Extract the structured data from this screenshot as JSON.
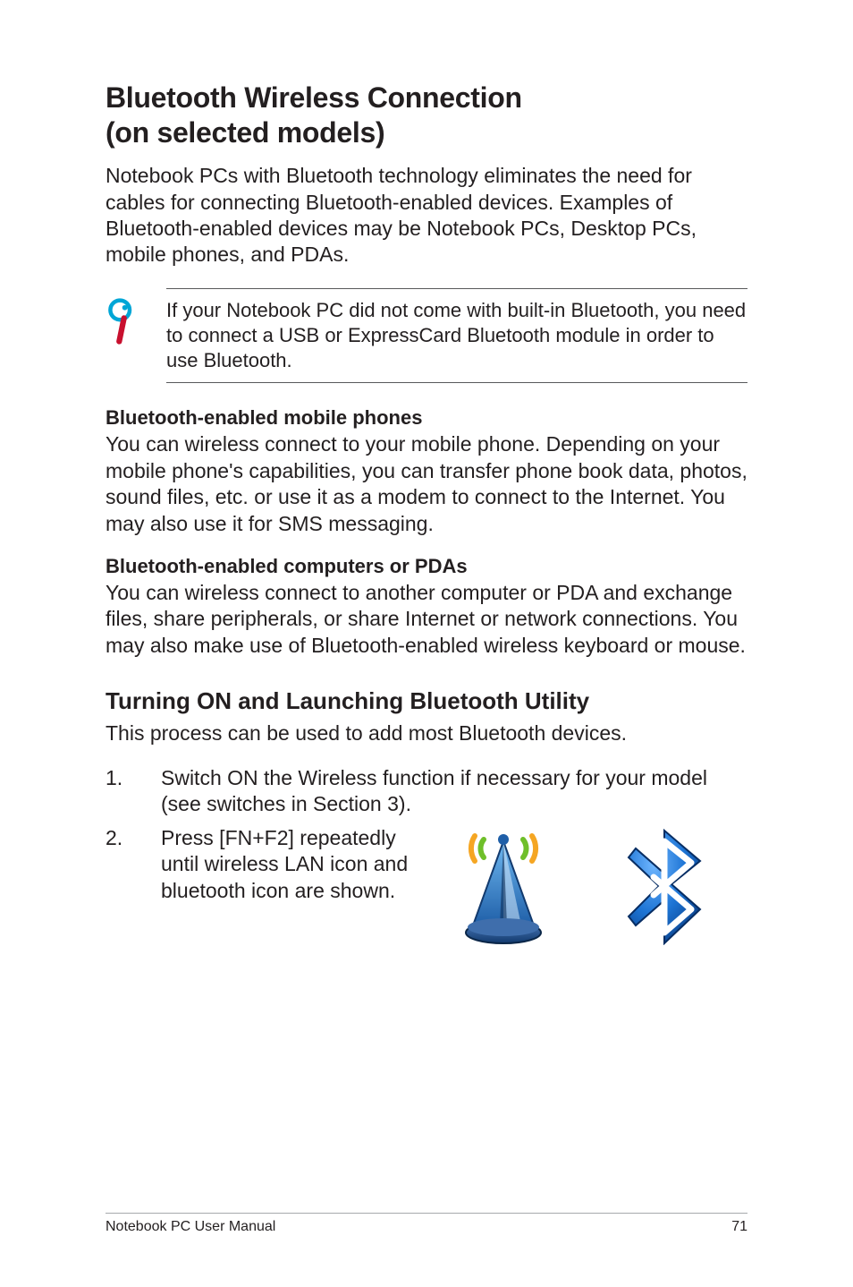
{
  "heading_line1": "Bluetooth Wireless Connection",
  "heading_line2": "(on selected models)",
  "intro": "Notebook PCs with Bluetooth technology eliminates the need for cables for connecting Bluetooth-enabled devices. Examples of Bluetooth-enabled devices may be Notebook PCs, Desktop PCs, mobile phones, and PDAs.",
  "tip": "If your Notebook PC did not come with built-in Bluetooth, you need to connect a USB or ExpressCard Bluetooth module in order to use Bluetooth.",
  "sub1_heading": "Bluetooth-enabled mobile phones",
  "sub1_body": "You can wireless connect to your mobile phone. Depending on your mobile phone's capabilities, you can transfer phone book data, photos, sound files, etc. or use it as a modem to connect to the Internet. You may also use it for SMS messaging.",
  "sub2_heading": "Bluetooth-enabled computers or PDAs",
  "sub2_body": "You can wireless connect to another computer or PDA and exchange files, share peripherals, or share Internet or network connections. You may also make use of Bluetooth-enabled wireless keyboard or mouse.",
  "section_heading": "Turning ON and Launching Bluetooth Utility",
  "section_lead": "This process can be used to add most Bluetooth devices.",
  "steps": {
    "s1_num": "1.",
    "s1_text": "Switch ON the Wireless function if necessary for your model (see switches in Section 3).",
    "s2_num": "2.",
    "s2_text": "Press [FN+F2] repeatedly until wireless LAN icon and bluetooth icon are shown."
  },
  "footer_left": "Notebook PC User Manual",
  "footer_right": "71"
}
